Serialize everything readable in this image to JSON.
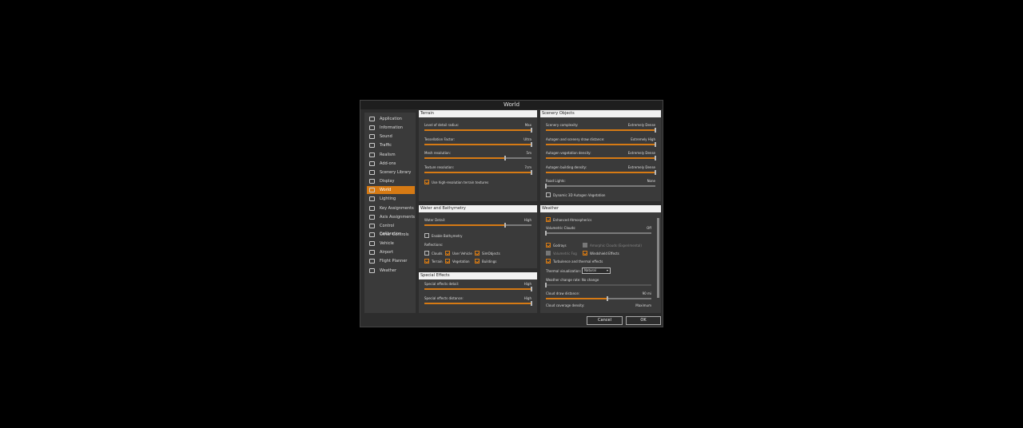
{
  "dialog": {
    "title": "World"
  },
  "nav": {
    "selected": "World",
    "items": [
      {
        "label": "Application",
        "icon": "gears-icon"
      },
      {
        "label": "Information",
        "icon": "info-icon"
      },
      {
        "label": "Sound",
        "icon": "speaker-icon"
      },
      {
        "label": "Traffic",
        "icon": "traffic-icon"
      },
      {
        "label": "Realism",
        "icon": "globe-icon"
      },
      {
        "label": "Add-ons",
        "icon": "addons-icon"
      },
      {
        "label": "Scenery Library",
        "icon": "image-icon"
      },
      {
        "label": "Display",
        "icon": "monitor-icon"
      },
      {
        "label": "World",
        "icon": "world-icon"
      },
      {
        "label": "Lighting",
        "icon": "lighting-icon"
      },
      {
        "label": "Key Assignments",
        "icon": "keyboard-icon"
      },
      {
        "label": "Axis Assignments",
        "icon": "axis-icon"
      },
      {
        "label": "Control Calibration",
        "icon": "calibration-icon"
      },
      {
        "label": "Other Controls",
        "icon": "controls-icon"
      },
      {
        "label": "Vehicle",
        "icon": "airplane-icon"
      },
      {
        "label": "Airport",
        "icon": "airport-icon"
      },
      {
        "label": "Flight Planner",
        "icon": "flight-planner-icon"
      },
      {
        "label": "Weather",
        "icon": "weather-icon"
      }
    ]
  },
  "terrain": {
    "header": "Terrain",
    "sliders": [
      {
        "label": "Level of detail radius:",
        "value": "Max",
        "level": 1.0
      },
      {
        "label": "Tessellation Factor:",
        "value": "Ultra",
        "level": 1.0
      },
      {
        "label": "Mesh resolution:",
        "value": "5m",
        "level": 0.75
      },
      {
        "label": "Texture resolution:",
        "value": "7cm",
        "level": 1.0
      }
    ],
    "high_res_label": "Use high-resolution terrain textures"
  },
  "scenery": {
    "header": "Scenery Objects",
    "sliders": [
      {
        "label": "Scenery complexity:",
        "value": "Extremely Dense",
        "level": 1.0
      },
      {
        "label": "Autogen and scenery draw distance:",
        "value": "Extremely High",
        "level": 1.0
      },
      {
        "label": "Autogen vegetation density:",
        "value": "Extremely Dense",
        "level": 1.0
      },
      {
        "label": "Autogen building density:",
        "value": "Extremely Dense",
        "level": 1.0
      },
      {
        "label": "Road Lights:",
        "value": "None",
        "level": 0.0
      }
    ],
    "dynamic_label": "Dynamic 3D Autogen Vegetation"
  },
  "water": {
    "header": "Water and Bathymetry",
    "slider": {
      "label": "Water Detail:",
      "value": "High",
      "level": 0.75
    },
    "bathymetry_label": "Enable Bathymetry",
    "reflections_label": "Reflections:",
    "reflections": [
      {
        "label": "Clouds",
        "checked": false
      },
      {
        "label": "User Vehicle",
        "checked": true
      },
      {
        "label": "SimObjects",
        "checked": true
      },
      {
        "label": "Terrain",
        "checked": true
      },
      {
        "label": "Vegetation",
        "checked": true
      },
      {
        "label": "Buildings",
        "checked": true
      }
    ]
  },
  "effects": {
    "header": "Special Effects",
    "sliders": [
      {
        "label": "Special effects detail:",
        "value": "High",
        "level": 1.0
      },
      {
        "label": "Special effects distance:",
        "value": "High",
        "level": 1.0
      }
    ]
  },
  "weather": {
    "header": "Weather",
    "enhanced_label": "Enhanced Atmospherics",
    "volumetric": {
      "label": "Volumetric Clouds:",
      "value": "Off",
      "level": 0.0
    },
    "godrays_label": "Godrays",
    "amorphic_label": "Amorphic Clouds (Experimental)",
    "fog_label": "Volumetric Fog",
    "windshield_label": "Windshield Effects",
    "turbulence_label": "Turbulence and thermal effects",
    "thermal_label": "Thermal visualization:",
    "thermal_value": "Natural",
    "change_label": "Weather change rate:",
    "change_value": "No change",
    "change_level": 0.0,
    "cloud_draw": {
      "label": "Cloud draw distance:",
      "value": "90 mi",
      "level": 0.58
    },
    "coverage": {
      "label": "Cloud coverage density:",
      "value": "Maximum"
    }
  },
  "buttons": {
    "cancel": "Cancel",
    "ok": "OK"
  }
}
